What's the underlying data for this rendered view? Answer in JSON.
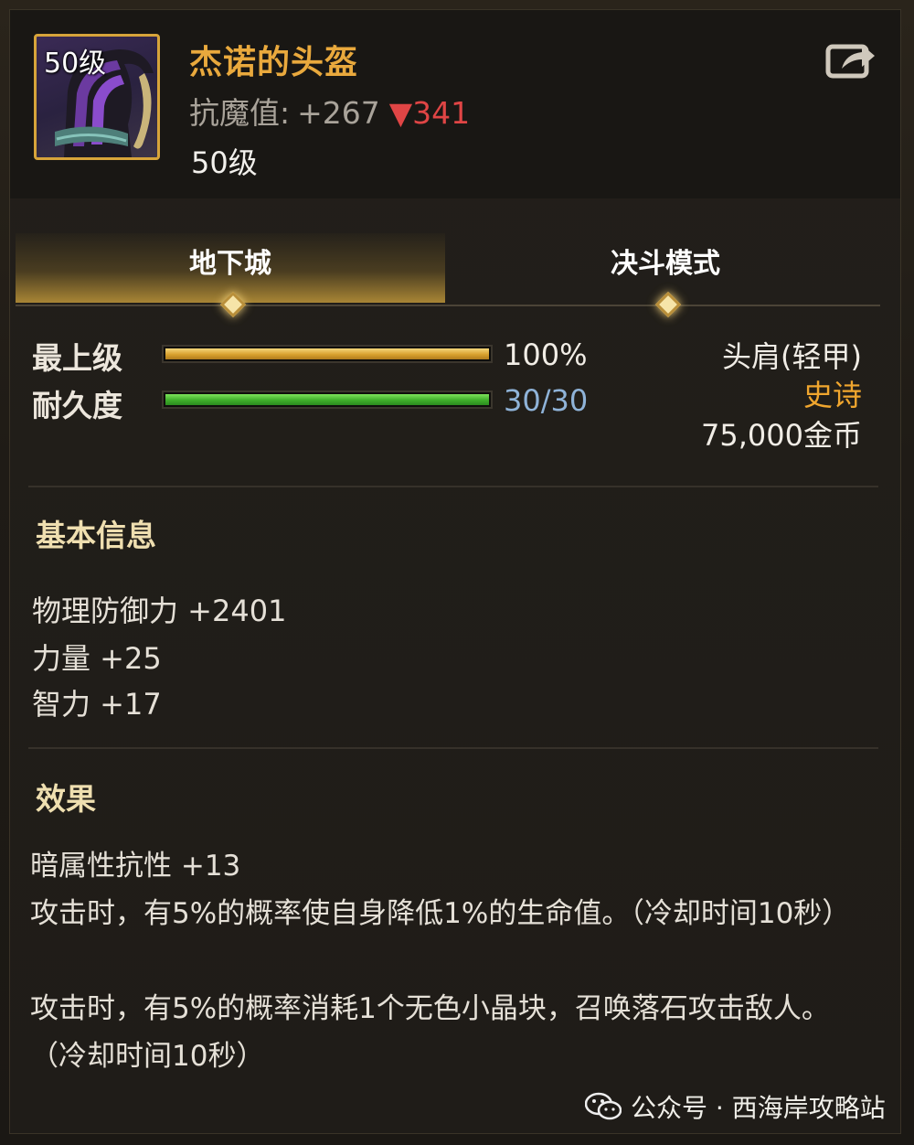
{
  "item": {
    "level_badge": "50级",
    "name": "杰诺的头盔",
    "magic_resist_label": "抗魔值:",
    "magic_resist_value": "+267",
    "magic_resist_diff": "▼341",
    "required_level": "50级"
  },
  "tabs": [
    {
      "label": "地下城",
      "active": true
    },
    {
      "label": "决斗模式",
      "active": false
    }
  ],
  "stats": {
    "grade_label": "最上级",
    "grade_value": "100%",
    "grade_fraction": 1.0,
    "durability_label": "耐久度",
    "durability_value": "30/30",
    "durability_fraction": 1.0
  },
  "type_info": {
    "slot": "头肩(轻甲)",
    "rarity": "史诗",
    "price": "75,000金币"
  },
  "basic_info": {
    "title": "基本信息",
    "attributes": [
      "物理防御力 +2401",
      "力量 +25",
      "智力 +17"
    ]
  },
  "effects": {
    "title": "效果",
    "lines": [
      "暗属性抗性 +13",
      "攻击时，有5%的概率使自身降低1%的生命值。（冷却时间10秒）",
      "攻击时，有5%的概率消耗1个无色小晶块，召唤落石攻击敌人。（冷却时间10秒）"
    ]
  },
  "watermark": {
    "text": "公众号 · 西海岸攻略站"
  },
  "colors": {
    "rarity_epic": "#f0a62e",
    "item_name": "#e9a93d",
    "diff_down": "#e04545"
  }
}
